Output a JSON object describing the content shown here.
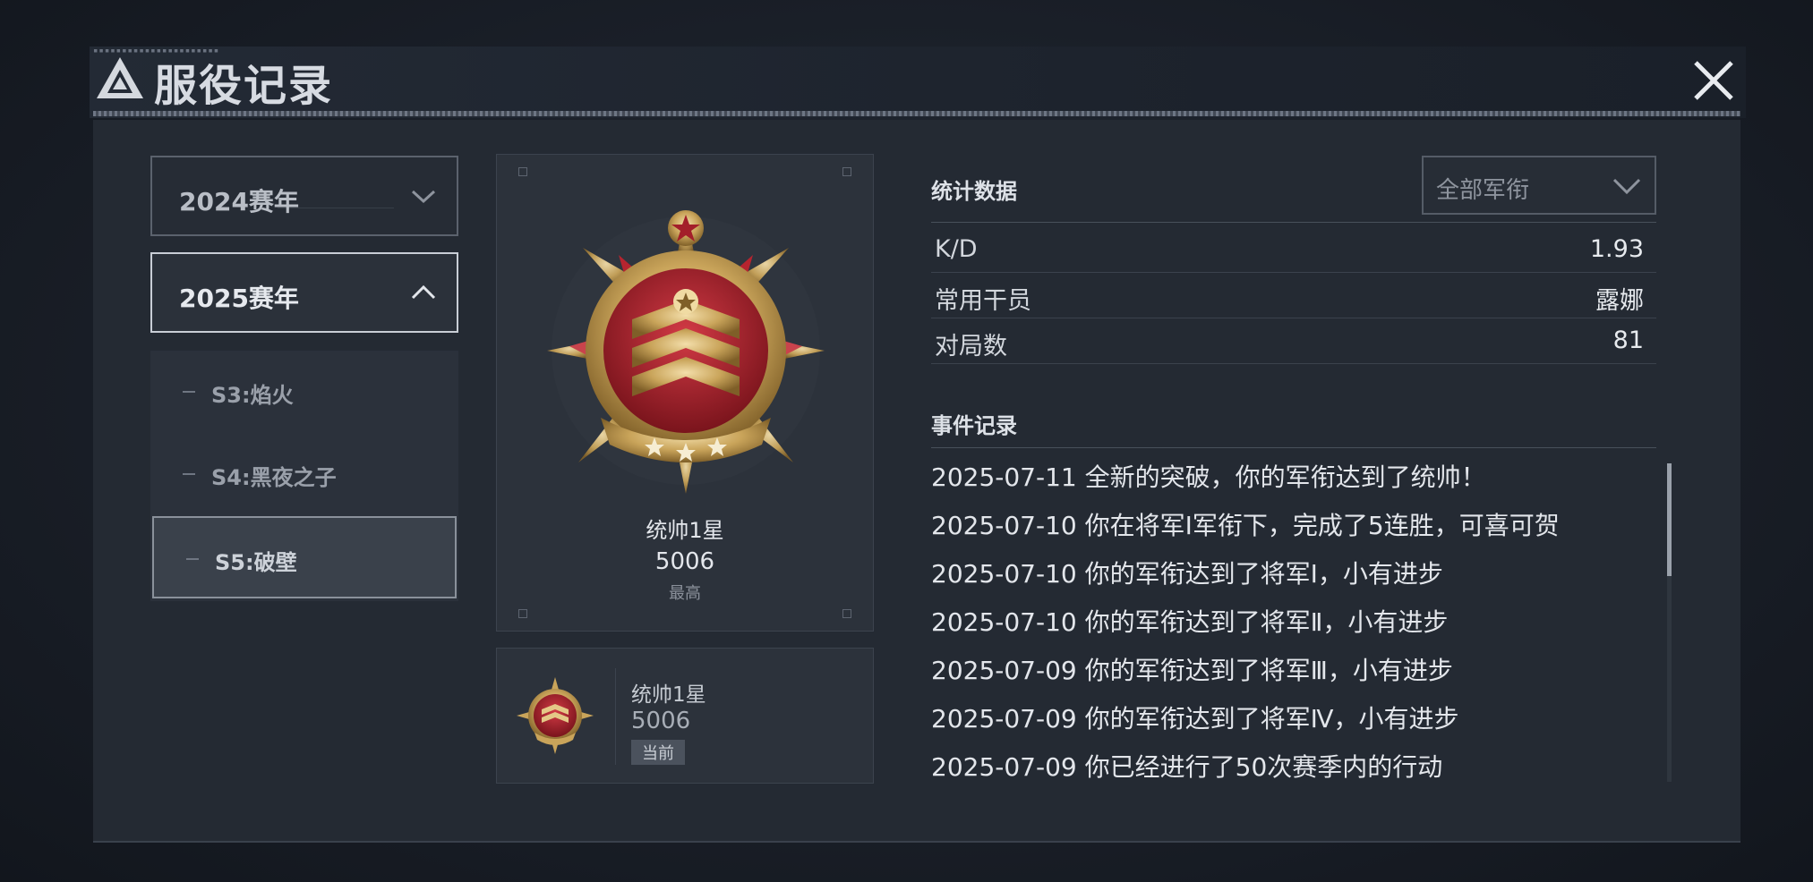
{
  "header": {
    "title": "服役记录",
    "close_icon": "close-icon"
  },
  "sidebar": {
    "years": [
      {
        "label": "2024赛年",
        "expanded": false
      },
      {
        "label": "2025赛年",
        "expanded": true
      }
    ],
    "seasons": [
      {
        "label": "S3:焰火",
        "selected": false
      },
      {
        "label": "S4:黑夜之子",
        "selected": false
      },
      {
        "label": "S5:破壁",
        "selected": true
      }
    ]
  },
  "highest_rank": {
    "name": "统帅1星",
    "score": "5006",
    "tag": "最高",
    "icon": "rank-medal-icon"
  },
  "current_rank": {
    "name": "统帅1星",
    "score": "5006",
    "tag": "当前",
    "icon": "rank-medal-icon"
  },
  "stats": {
    "title": "统计数据",
    "filter_label": "全部军衔",
    "rows": [
      {
        "label": "K/D",
        "value": "1.93"
      },
      {
        "label": "常用干员",
        "value": "露娜"
      },
      {
        "label": "对局数",
        "value": "81"
      }
    ]
  },
  "events": {
    "title": "事件记录",
    "items": [
      "2025-07-11 全新的突破，你的军衔达到了统帅！",
      "2025-07-10 你在将军Ⅰ军衔下，完成了5连胜，可喜可贺",
      "2025-07-10 你的军衔达到了将军Ⅰ，小有进步",
      "2025-07-10 你的军衔达到了将军Ⅱ，小有进步",
      "2025-07-09 你的军衔达到了将军Ⅲ，小有进步",
      "2025-07-09 你的军衔达到了将军Ⅳ，小有进步",
      "2025-07-09 你已经进行了50次赛季内的行动"
    ]
  },
  "colors": {
    "panel": "#242a33",
    "accent_gold": "#c9a45a",
    "accent_red": "#a31f2a"
  }
}
